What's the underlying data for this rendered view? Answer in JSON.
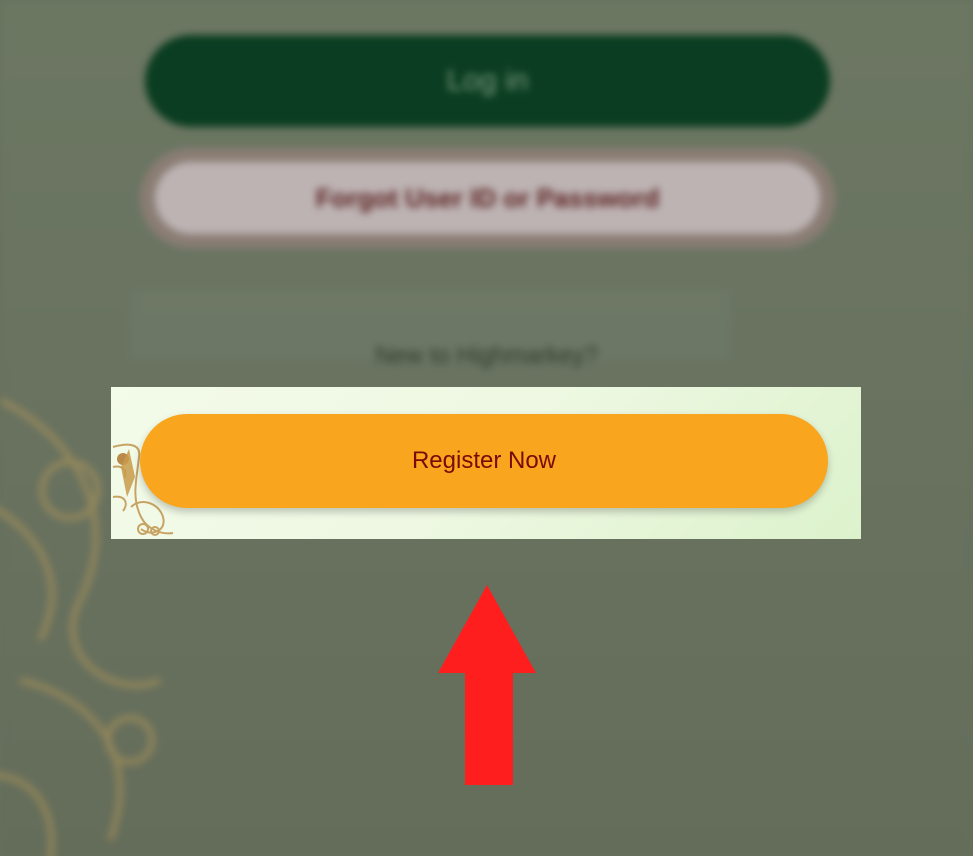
{
  "background": {
    "login_label": "Log in",
    "forgot_label": "Forgot User ID or Password",
    "new_user_text": "New to Highmarkey?"
  },
  "highlight": {
    "register_label": "Register Now"
  },
  "colors": {
    "register_button": "#f9a51e",
    "register_text": "#7a0a0a",
    "login_button": "#053a1e",
    "arrow": "#ff1e1e"
  },
  "icons": {
    "arrow": "arrow-up-icon",
    "ornament": "decorative-ornament-icon"
  }
}
